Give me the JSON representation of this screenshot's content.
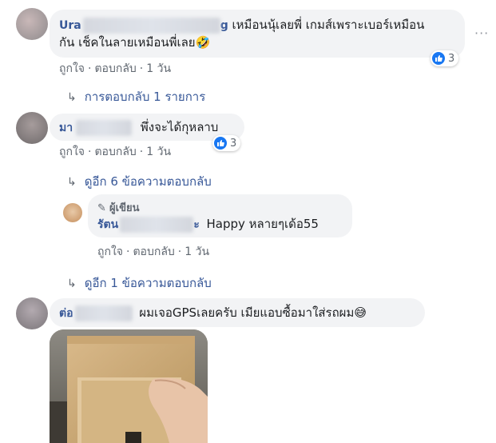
{
  "comments": [
    {
      "name_visible": "Ura",
      "name_tail": "g",
      "text_line1": "เหมือนนุ้เลยพี่ เกมส์เพราะเบอร์เหมือน",
      "text_line2": "กัน เช็คในลายเหมือนพี่เลย🤣",
      "like_label": "ถูกใจ",
      "reply_label": "ตอบกลับ",
      "time": "1 วัน",
      "reaction_count": "3",
      "replies_link": "การตอบกลับ 1 รายการ"
    },
    {
      "name_visible": "มา",
      "text": "พึ่งจะได้กุหลาบ",
      "like_label": "ถูกใจ",
      "reply_label": "ตอบกลับ",
      "time": "1 วัน",
      "reaction_count": "3",
      "replies_link": "ดูอีก 6 ข้อความตอบกลับ",
      "reply": {
        "author_badge": "ผู้เขียน",
        "name_visible": "รัตน",
        "name_tail": "ะ",
        "text": "Happy หลายๆเด้อ55",
        "like_label": "ถูกใจ",
        "reply_label": "ตอบกลับ",
        "time": "1 วัน"
      },
      "more_replies_link": "ดูอีก 1 ข้อความตอบกลับ"
    },
    {
      "name_visible": "ต่อ",
      "text": "ผมเจอGPSเลยครับ เมียแอบซื้อมาใส่รถผม😅"
    }
  ],
  "icons": {
    "options": "more-options-icon",
    "reply_arrow": "reply-arrow-icon",
    "like": "like-icon",
    "pencil": "pencil-icon"
  },
  "colors": {
    "link": "#385898",
    "bubble": "#f2f3f5",
    "meta": "#606770",
    "like_blue": "#1877f2"
  }
}
